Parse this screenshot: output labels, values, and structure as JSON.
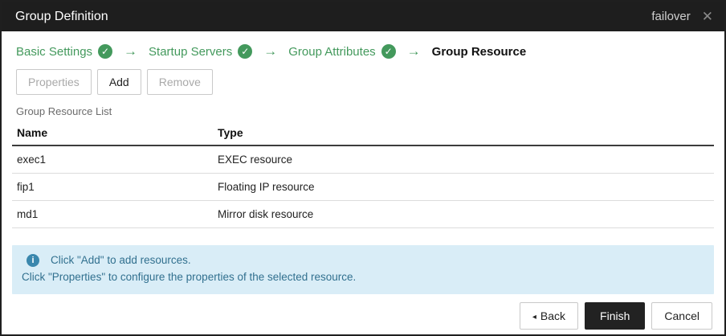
{
  "dialog": {
    "title": "Group Definition",
    "context_label": "failover",
    "close_icon": "✕"
  },
  "wizard": {
    "check_glyph": "✓",
    "arrow_glyph": "→",
    "steps": [
      {
        "label": "Basic Settings",
        "state": "done"
      },
      {
        "label": "Startup Servers",
        "state": "done"
      },
      {
        "label": "Group Attributes",
        "state": "done"
      },
      {
        "label": "Group Resource",
        "state": "current"
      }
    ]
  },
  "toolbar": {
    "properties_label": "Properties",
    "add_label": "Add",
    "remove_label": "Remove"
  },
  "resource_list": {
    "label": "Group Resource List",
    "columns": [
      "Name",
      "Type"
    ],
    "rows": [
      {
        "name": "exec1",
        "type": "EXEC resource"
      },
      {
        "name": "fip1",
        "type": "Floating IP resource"
      },
      {
        "name": "md1",
        "type": "Mirror disk resource"
      }
    ]
  },
  "info": {
    "icon_glyph": "i",
    "line1": "Click \"Add\" to add resources.",
    "line2": "Click \"Properties\" to configure the properties of the selected resource."
  },
  "footer": {
    "back_arrow": "◂",
    "back_label": "Back",
    "finish_label": "Finish",
    "cancel_label": "Cancel"
  },
  "colors": {
    "accent_green": "#43995c",
    "titlebar_bg": "#1e1e1e",
    "info_bg": "#d9edf7",
    "info_text": "#31708f",
    "info_icon_bg": "#3a87ad",
    "primary_button_bg": "#222222"
  }
}
